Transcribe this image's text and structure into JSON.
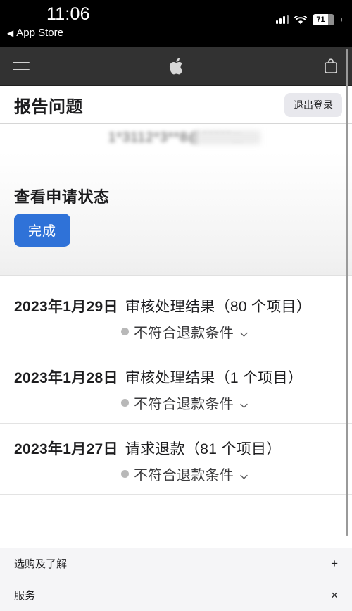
{
  "statusbar": {
    "time": "11:06",
    "back_label": "App Store",
    "back_arrow": "◀",
    "battery_level": "71",
    "battery_percent": 71
  },
  "applenav": {
    "menu_icon": "hamburger-menu-icon",
    "logo_icon": "apple-logo-icon",
    "bag_icon": "shopping-bag-icon"
  },
  "header": {
    "title": "报告问题",
    "signout_label": "退出登录"
  },
  "account": {
    "email_redacted": "1*3112*3**8@*****m"
  },
  "status_panel": {
    "heading": "查看申请状态",
    "done_label": "完成",
    "accent_color": "#2f72d8"
  },
  "requests": [
    {
      "date": "2023年1月29日",
      "title": "审核处理结果（80 个项目）",
      "status": "不符合退款条件",
      "status_dot_color": "#b8b8b8"
    },
    {
      "date": "2023年1月28日",
      "title": "审核处理结果（1 个项目）",
      "status": "不符合退款条件",
      "status_dot_color": "#b8b8b8"
    },
    {
      "date": "2023年1月27日",
      "title": "请求退款（81 个项目）",
      "status": "不符合退款条件",
      "status_dot_color": "#b8b8b8"
    }
  ],
  "footer": {
    "rows": [
      {
        "label": "选购及了解",
        "sign": "+"
      },
      {
        "label": "服务",
        "sign": "×"
      }
    ]
  }
}
